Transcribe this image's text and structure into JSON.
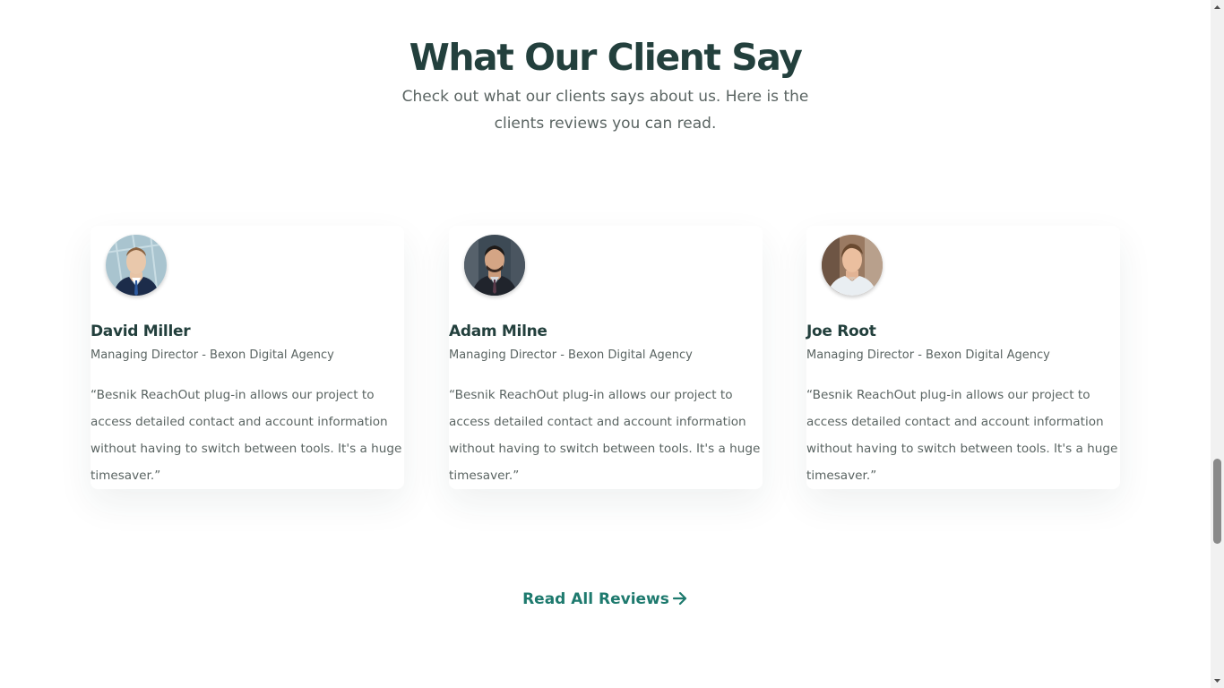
{
  "section": {
    "title": "What Our Client Say",
    "subtitle": "Check out what our clients says about us. Here is the clients reviews you can read."
  },
  "testimonials": [
    {
      "name": "David Miller",
      "role": "Managing Director - Bexon Digital Agency",
      "quote": "“Besnik ReachOut plug-in allows our project to access detailed contact and account information without having to switch between tools. It's a huge timesaver.”",
      "avatar": "avatar-man-blue-suit"
    },
    {
      "name": "Adam Milne",
      "role": "Managing Director - Bexon Digital Agency",
      "quote": "“Besnik ReachOut plug-in allows our project to access detailed contact and account information without having to switch between tools. It's a huge timesaver.”",
      "avatar": "avatar-man-dark-suit"
    },
    {
      "name": "Joe Root",
      "role": "Managing Director - Bexon Digital Agency",
      "quote": "“Besnik ReachOut plug-in allows our project to access detailed contact and account information without having to switch between tools. It's a huge timesaver.”",
      "avatar": "avatar-man-casual"
    }
  ],
  "cta": {
    "label": "Read All Reviews",
    "icon": "arrow-right-icon"
  },
  "colors": {
    "heading": "#23403d",
    "body_text": "#5a6462",
    "accent": "#1e7a6e",
    "background": "#ffffff"
  }
}
